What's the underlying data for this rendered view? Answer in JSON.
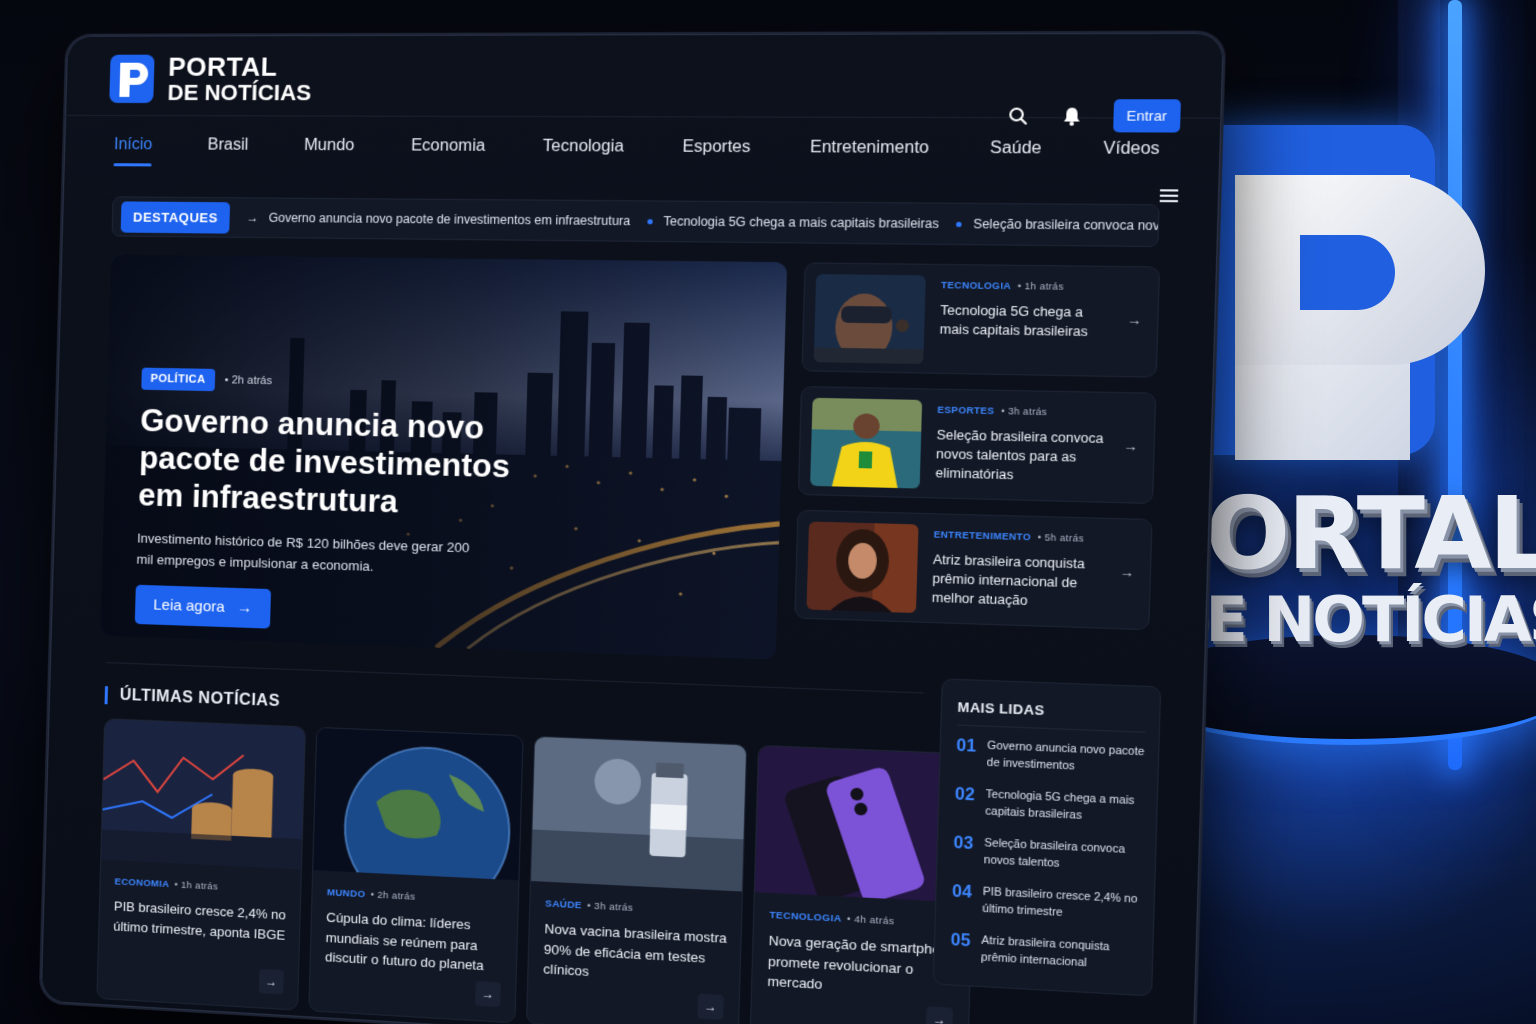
{
  "brand": {
    "line1": "PORTAL",
    "line2": "DE NOTÍCIAS",
    "accent": "#1e63f0"
  },
  "header": {
    "search_icon": "search-icon",
    "bell_icon": "bell-icon",
    "login_label": "Entrar"
  },
  "nav": {
    "items": [
      "Início",
      "Brasil",
      "Mundo",
      "Economia",
      "Tecnologia",
      "Esportes",
      "Entretenimento",
      "Saúde",
      "Vídeos"
    ],
    "active": "Início"
  },
  "ticker": {
    "badge": "DESTAQUES",
    "items": [
      "Governo anuncia novo pacote de investimentos em infraestrutura",
      "Tecnologia 5G chega a mais capitais brasileiras",
      "Seleção brasileira convoca novos talentos"
    ]
  },
  "hero": {
    "category": "POLÍTICA",
    "time": "2h atrás",
    "title": "Governo anuncia novo pacote de investimentos em infraestrutura",
    "description": "Investimento histórico de R$ 120 bilhões deve gerar 200 mil empregos e impulsionar a economia.",
    "cta": "Leia agora"
  },
  "side_stories": [
    {
      "category": "TECNOLOGIA",
      "time": "1h atrás",
      "title": "Tecnologia 5G chega a mais capitais brasileiras"
    },
    {
      "category": "ESPORTES",
      "time": "3h atrás",
      "title": "Seleção brasileira convoca novos talentos para as eliminatórias"
    },
    {
      "category": "ENTRETENIMENTO",
      "time": "5h atrás",
      "title": "Atriz brasileira conquista prêmio internacional de melhor atuação"
    }
  ],
  "latest": {
    "title": "ÚLTIMAS NOTÍCIAS",
    "items": [
      {
        "category": "ECONOMIA",
        "time": "1h atrás",
        "title": "PIB brasileiro cresce 2,4% no último trimestre, aponta IBGE"
      },
      {
        "category": "MUNDO",
        "time": "2h atrás",
        "title": "Cúpula do clima: líderes mundiais se reúnem para discutir o futuro do planeta"
      },
      {
        "category": "SAÚDE",
        "time": "3h atrás",
        "title": "Nova vacina brasileira mostra 90% de eficácia em testes clínicos"
      },
      {
        "category": "TECNOLOGIA",
        "time": "4h atrás",
        "title": "Nova geração de smartphones promete revolucionar o mercado"
      }
    ]
  },
  "most_read": {
    "title": "MAIS LIDAS",
    "items": [
      {
        "num": "01",
        "title": "Governo anuncia novo pacote de investimentos"
      },
      {
        "num": "02",
        "title": "Tecnologia 5G chega a mais capitais brasileiras"
      },
      {
        "num": "03",
        "title": "Seleção brasileira convoca novos talentos"
      },
      {
        "num": "04",
        "title": "PIB brasileiro cresce 2,4% no último trimestre"
      },
      {
        "num": "05",
        "title": "Atriz brasileira conquista prêmio internacional"
      }
    ]
  }
}
